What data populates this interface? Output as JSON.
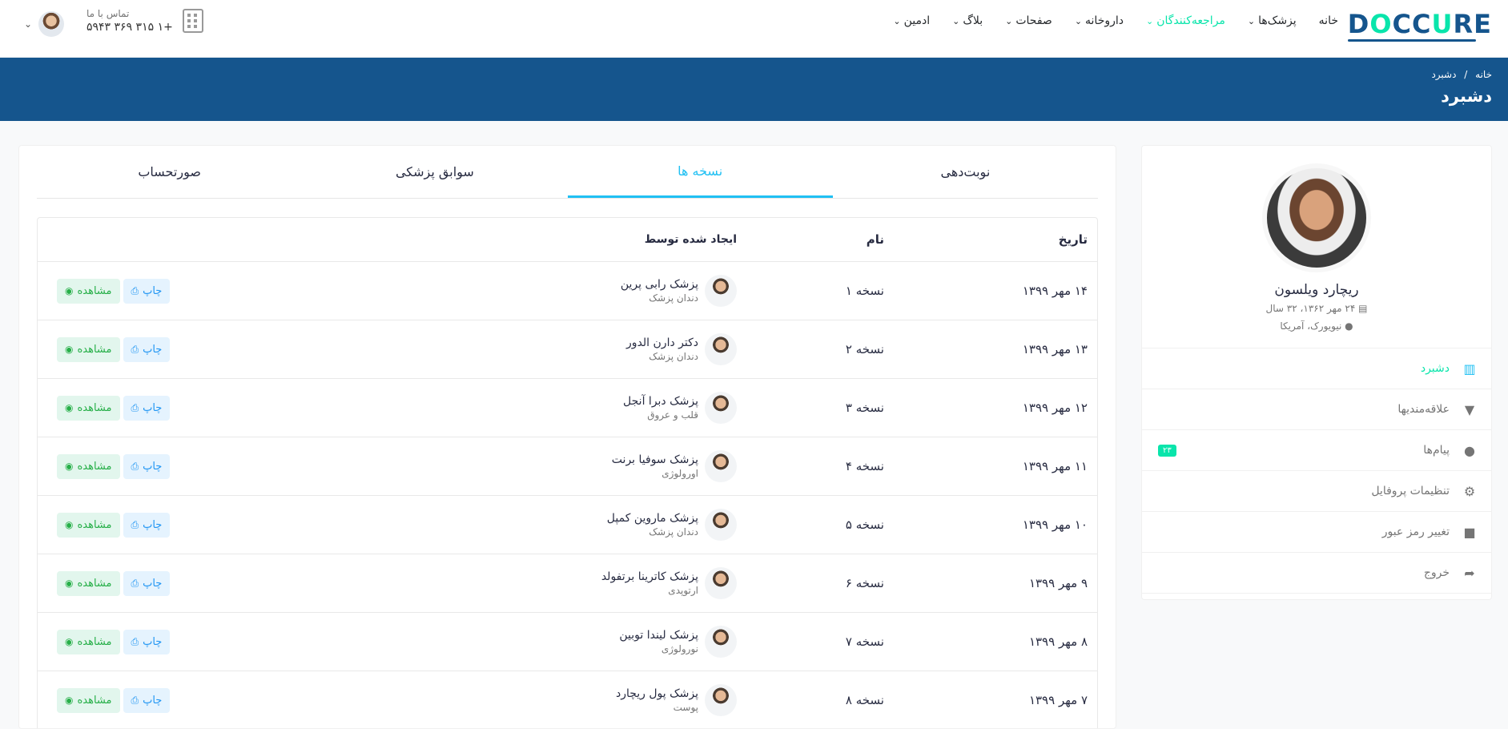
{
  "header": {
    "logo": {
      "text_pre": "D",
      "text_o1": "O",
      "text_mid": "CC",
      "text_u": "U",
      "text_post": "RE"
    },
    "nav": [
      {
        "label": "خانه",
        "has_dropdown": false,
        "active": false
      },
      {
        "label": "پزشک‌ها",
        "has_dropdown": true,
        "active": false
      },
      {
        "label": "مراجعه‌کنندگان",
        "has_dropdown": true,
        "active": true
      },
      {
        "label": "داروخانه",
        "has_dropdown": true,
        "active": false
      },
      {
        "label": "صفحات",
        "has_dropdown": true,
        "active": false
      },
      {
        "label": "بلاگ",
        "has_dropdown": true,
        "active": false
      },
      {
        "label": "ادمین",
        "has_dropdown": true,
        "active": false
      }
    ],
    "contact_label": "تماس با ما",
    "contact_phone": "+۱ ۳۱۵ ۳۶۹ ۵۹۴۳"
  },
  "breadcrumb": {
    "home": "خانه",
    "sep": "/",
    "current": "دشبرد",
    "title": "دشبرد"
  },
  "profile": {
    "name": "ریچارد ویلسون",
    "dob": "۲۴ مهر ۱۳۶۲، ۳۲ سال",
    "location": "نیویورک، آمریکا",
    "menu": [
      {
        "label": "دشبرد",
        "icon": "columns-icon",
        "active": true
      },
      {
        "label": "علاقه‌مندیها",
        "icon": "bookmark-icon",
        "active": false
      },
      {
        "label": "پیام‌ها",
        "icon": "comments-icon",
        "active": false,
        "badge": "۲۳"
      },
      {
        "label": "تنظیمات پروفایل",
        "icon": "user-cog-icon",
        "active": false
      },
      {
        "label": "تغییر رمز عبور",
        "icon": "lock-icon",
        "active": false
      },
      {
        "label": "خروج",
        "icon": "sign-out-icon",
        "active": false
      }
    ]
  },
  "tabs": [
    {
      "label": "نوبت‌دهی",
      "active": false
    },
    {
      "label": "نسخه ها",
      "active": true
    },
    {
      "label": "سوابق پزشکی",
      "active": false
    },
    {
      "label": "صورتحساب",
      "active": false
    }
  ],
  "table": {
    "columns": {
      "date": "تاریخ",
      "name": "نام",
      "created_by": "ایجاد شده توسط"
    },
    "print_label": "چاپ",
    "view_label": "مشاهده",
    "rows": [
      {
        "date": "۱۴ مهر ۱۳۹۹",
        "name": "نسخه ۱",
        "doctor": "پزشک رابی پرین",
        "specialty": "دندان پزشک"
      },
      {
        "date": "۱۳ مهر ۱۳۹۹",
        "name": "نسخه ۲",
        "doctor": "دکتر دارن الدور",
        "specialty": "دندان پزشک"
      },
      {
        "date": "۱۲ مهر ۱۳۹۹",
        "name": "نسخه ۳",
        "doctor": "پزشک دبرا آنجل",
        "specialty": "قلب و عروق"
      },
      {
        "date": "۱۱ مهر ۱۳۹۹",
        "name": "نسخه ۴",
        "doctor": "پزشک سوفیا برنت",
        "specialty": "اورولوژی"
      },
      {
        "date": "۱۰ مهر ۱۳۹۹",
        "name": "نسخه ۵",
        "doctor": "پزشک ماروین کمپل",
        "specialty": "دندان پزشک"
      },
      {
        "date": "۹ مهر ۱۳۹۹",
        "name": "نسخه ۶",
        "doctor": "پزشک کاترینا برتفولد",
        "specialty": "ارتوپدی"
      },
      {
        "date": "۸ مهر ۱۳۹۹",
        "name": "نسخه ۷",
        "doctor": "پزشک لیندا توبین",
        "specialty": "نورولوژی"
      },
      {
        "date": "۷ مهر ۱۳۹۹",
        "name": "نسخه ۸",
        "doctor": "پزشک پول ریچارد",
        "specialty": "پوست"
      }
    ]
  },
  "colors": {
    "brand": "#15558d",
    "accent": "#09e5ab",
    "tab_active": "#20c0f3",
    "view_btn": "#26af48",
    "print_btn": "#2196f3"
  }
}
